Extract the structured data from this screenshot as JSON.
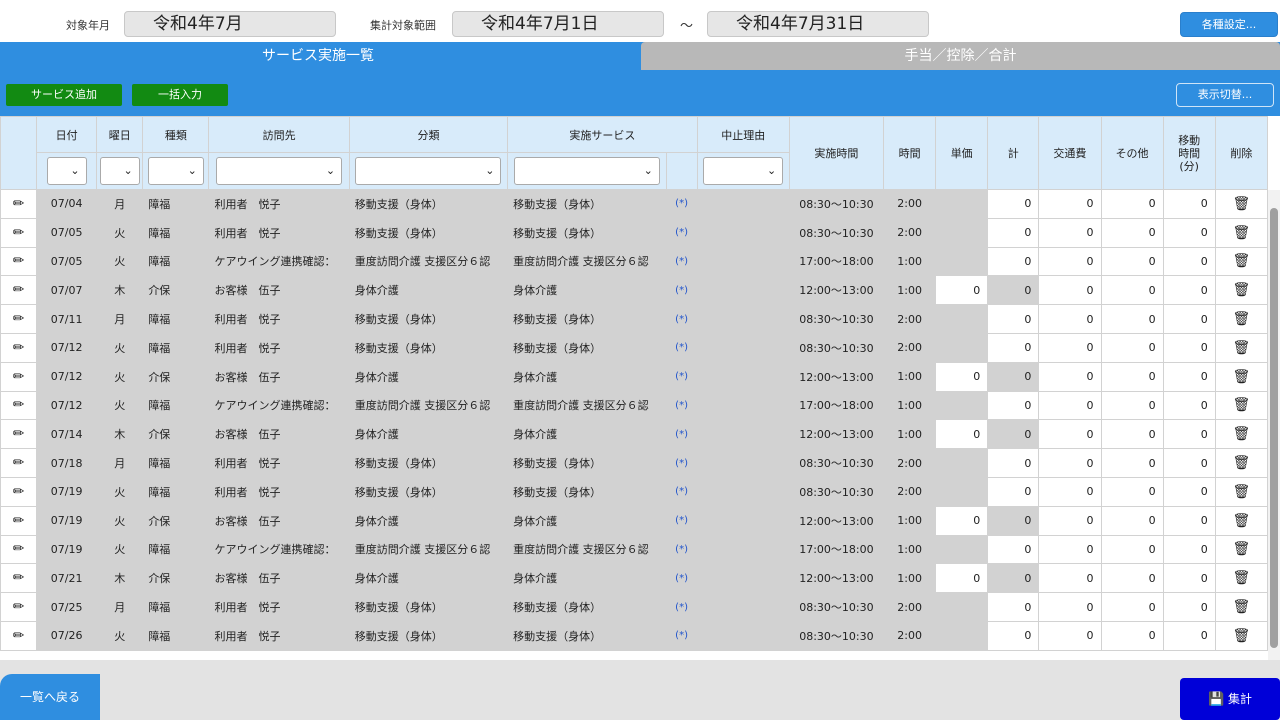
{
  "header": {
    "target_month_label": "対象年月",
    "target_month_value": "令和4年7月",
    "range_label": "集計対象範囲",
    "range_start": "令和4年7月1日",
    "range_separator": "～",
    "range_end": "令和4年7月31日",
    "settings_label": "各種設定..."
  },
  "tabs": [
    {
      "label": "サービス実施一覧",
      "active": true
    },
    {
      "label": "手当／控除／合計",
      "active": false
    }
  ],
  "toolbar": {
    "add_service": "サービス追加",
    "bulk_input": "一括入力",
    "display_toggle": "表示切替..."
  },
  "columns": {
    "date": "日付",
    "weekday": "曜日",
    "kind": "種類",
    "visit": "訪問先",
    "category": "分類",
    "service": "実施サービス",
    "cancel_reason": "中止理由",
    "time_range": "実施時間",
    "hours": "時間",
    "unit_price": "単価",
    "total": "計",
    "transport": "交通費",
    "other": "その他",
    "travel_time": "移動時間(分)",
    "delete": "削除"
  },
  "rows": [
    {
      "date": "07/04",
      "wd": "月",
      "kind": "障福",
      "visit": "利用者　悦子",
      "cat": "移動支援（身体）",
      "svc": "移動支援（身体）",
      "link": "(*)",
      "time": "08:30～10:30",
      "hrs": "2:00",
      "unit": "",
      "total": "0",
      "trans": "0",
      "other": "0",
      "travel": "0"
    },
    {
      "date": "07/05",
      "wd": "火",
      "kind": "障福",
      "visit": "利用者　悦子",
      "cat": "移動支援（身体）",
      "svc": "移動支援（身体）",
      "link": "(*)",
      "time": "08:30～10:30",
      "hrs": "2:00",
      "unit": "",
      "total": "0",
      "trans": "0",
      "other": "0",
      "travel": "0"
    },
    {
      "date": "07/05",
      "wd": "火",
      "kind": "障福",
      "visit": "ケアウイング連携確認：",
      "cat": "重度訪問介護 支援区分６認",
      "svc": "重度訪問介護 支援区分６認",
      "link": "(*)",
      "time": "17:00～18:00",
      "hrs": "1:00",
      "unit": "",
      "total": "0",
      "trans": "0",
      "other": "0",
      "travel": "0"
    },
    {
      "date": "07/07",
      "wd": "木",
      "kind": "介保",
      "visit": "お客様　伍子",
      "cat": "身体介護",
      "svc": "身体介護",
      "link": "(*)",
      "time": "12:00～13:00",
      "hrs": "1:00",
      "unit": "0",
      "total": "0",
      "trans": "0",
      "other": "0",
      "travel": "0"
    },
    {
      "date": "07/11",
      "wd": "月",
      "kind": "障福",
      "visit": "利用者　悦子",
      "cat": "移動支援（身体）",
      "svc": "移動支援（身体）",
      "link": "(*)",
      "time": "08:30～10:30",
      "hrs": "2:00",
      "unit": "",
      "total": "0",
      "trans": "0",
      "other": "0",
      "travel": "0"
    },
    {
      "date": "07/12",
      "wd": "火",
      "kind": "障福",
      "visit": "利用者　悦子",
      "cat": "移動支援（身体）",
      "svc": "移動支援（身体）",
      "link": "(*)",
      "time": "08:30～10:30",
      "hrs": "2:00",
      "unit": "",
      "total": "0",
      "trans": "0",
      "other": "0",
      "travel": "0"
    },
    {
      "date": "07/12",
      "wd": "火",
      "kind": "介保",
      "visit": "お客様　伍子",
      "cat": "身体介護",
      "svc": "身体介護",
      "link": "(*)",
      "time": "12:00～13:00",
      "hrs": "1:00",
      "unit": "0",
      "total": "0",
      "trans": "0",
      "other": "0",
      "travel": "0"
    },
    {
      "date": "07/12",
      "wd": "火",
      "kind": "障福",
      "visit": "ケアウイング連携確認：",
      "cat": "重度訪問介護 支援区分６認",
      "svc": "重度訪問介護 支援区分６認",
      "link": "(*)",
      "time": "17:00～18:00",
      "hrs": "1:00",
      "unit": "",
      "total": "0",
      "trans": "0",
      "other": "0",
      "travel": "0"
    },
    {
      "date": "07/14",
      "wd": "木",
      "kind": "介保",
      "visit": "お客様　伍子",
      "cat": "身体介護",
      "svc": "身体介護",
      "link": "(*)",
      "time": "12:00～13:00",
      "hrs": "1:00",
      "unit": "0",
      "total": "0",
      "trans": "0",
      "other": "0",
      "travel": "0"
    },
    {
      "date": "07/18",
      "wd": "月",
      "kind": "障福",
      "visit": "利用者　悦子",
      "cat": "移動支援（身体）",
      "svc": "移動支援（身体）",
      "link": "(*)",
      "time": "08:30～10:30",
      "hrs": "2:00",
      "unit": "",
      "total": "0",
      "trans": "0",
      "other": "0",
      "travel": "0"
    },
    {
      "date": "07/19",
      "wd": "火",
      "kind": "障福",
      "visit": "利用者　悦子",
      "cat": "移動支援（身体）",
      "svc": "移動支援（身体）",
      "link": "(*)",
      "time": "08:30～10:30",
      "hrs": "2:00",
      "unit": "",
      "total": "0",
      "trans": "0",
      "other": "0",
      "travel": "0"
    },
    {
      "date": "07/19",
      "wd": "火",
      "kind": "介保",
      "visit": "お客様　伍子",
      "cat": "身体介護",
      "svc": "身体介護",
      "link": "(*)",
      "time": "12:00～13:00",
      "hrs": "1:00",
      "unit": "0",
      "total": "0",
      "trans": "0",
      "other": "0",
      "travel": "0"
    },
    {
      "date": "07/19",
      "wd": "火",
      "kind": "障福",
      "visit": "ケアウイング連携確認：",
      "cat": "重度訪問介護 支援区分６認",
      "svc": "重度訪問介護 支援区分６認",
      "link": "(*)",
      "time": "17:00～18:00",
      "hrs": "1:00",
      "unit": "",
      "total": "0",
      "trans": "0",
      "other": "0",
      "travel": "0"
    },
    {
      "date": "07/21",
      "wd": "木",
      "kind": "介保",
      "visit": "お客様　伍子",
      "cat": "身体介護",
      "svc": "身体介護",
      "link": "(*)",
      "time": "12:00～13:00",
      "hrs": "1:00",
      "unit": "0",
      "total": "0",
      "trans": "0",
      "other": "0",
      "travel": "0"
    },
    {
      "date": "07/25",
      "wd": "月",
      "kind": "障福",
      "visit": "利用者　悦子",
      "cat": "移動支援（身体）",
      "svc": "移動支援（身体）",
      "link": "(*)",
      "time": "08:30～10:30",
      "hrs": "2:00",
      "unit": "",
      "total": "0",
      "trans": "0",
      "other": "0",
      "travel": "0"
    },
    {
      "date": "07/26",
      "wd": "火",
      "kind": "障福",
      "visit": "利用者　悦子",
      "cat": "移動支援（身体）",
      "svc": "移動支援（身体）",
      "link": "(*)",
      "time": "08:30～10:30",
      "hrs": "2:00",
      "unit": "",
      "total": "0",
      "trans": "0",
      "other": "0",
      "travel": "0"
    }
  ],
  "footer": {
    "back_label": "一覧へ戻る",
    "aggregate_label": "集計"
  },
  "icons": {
    "edit": "pencil-icon",
    "delete": "trash-icon",
    "save": "floppy-disk-icon",
    "dropdown": "chevron-down-icon"
  },
  "colors": {
    "primary": "#2f8ee0",
    "green": "#128a12",
    "aggregate": "#0000d8",
    "header_cell": "#d8ebfa"
  }
}
